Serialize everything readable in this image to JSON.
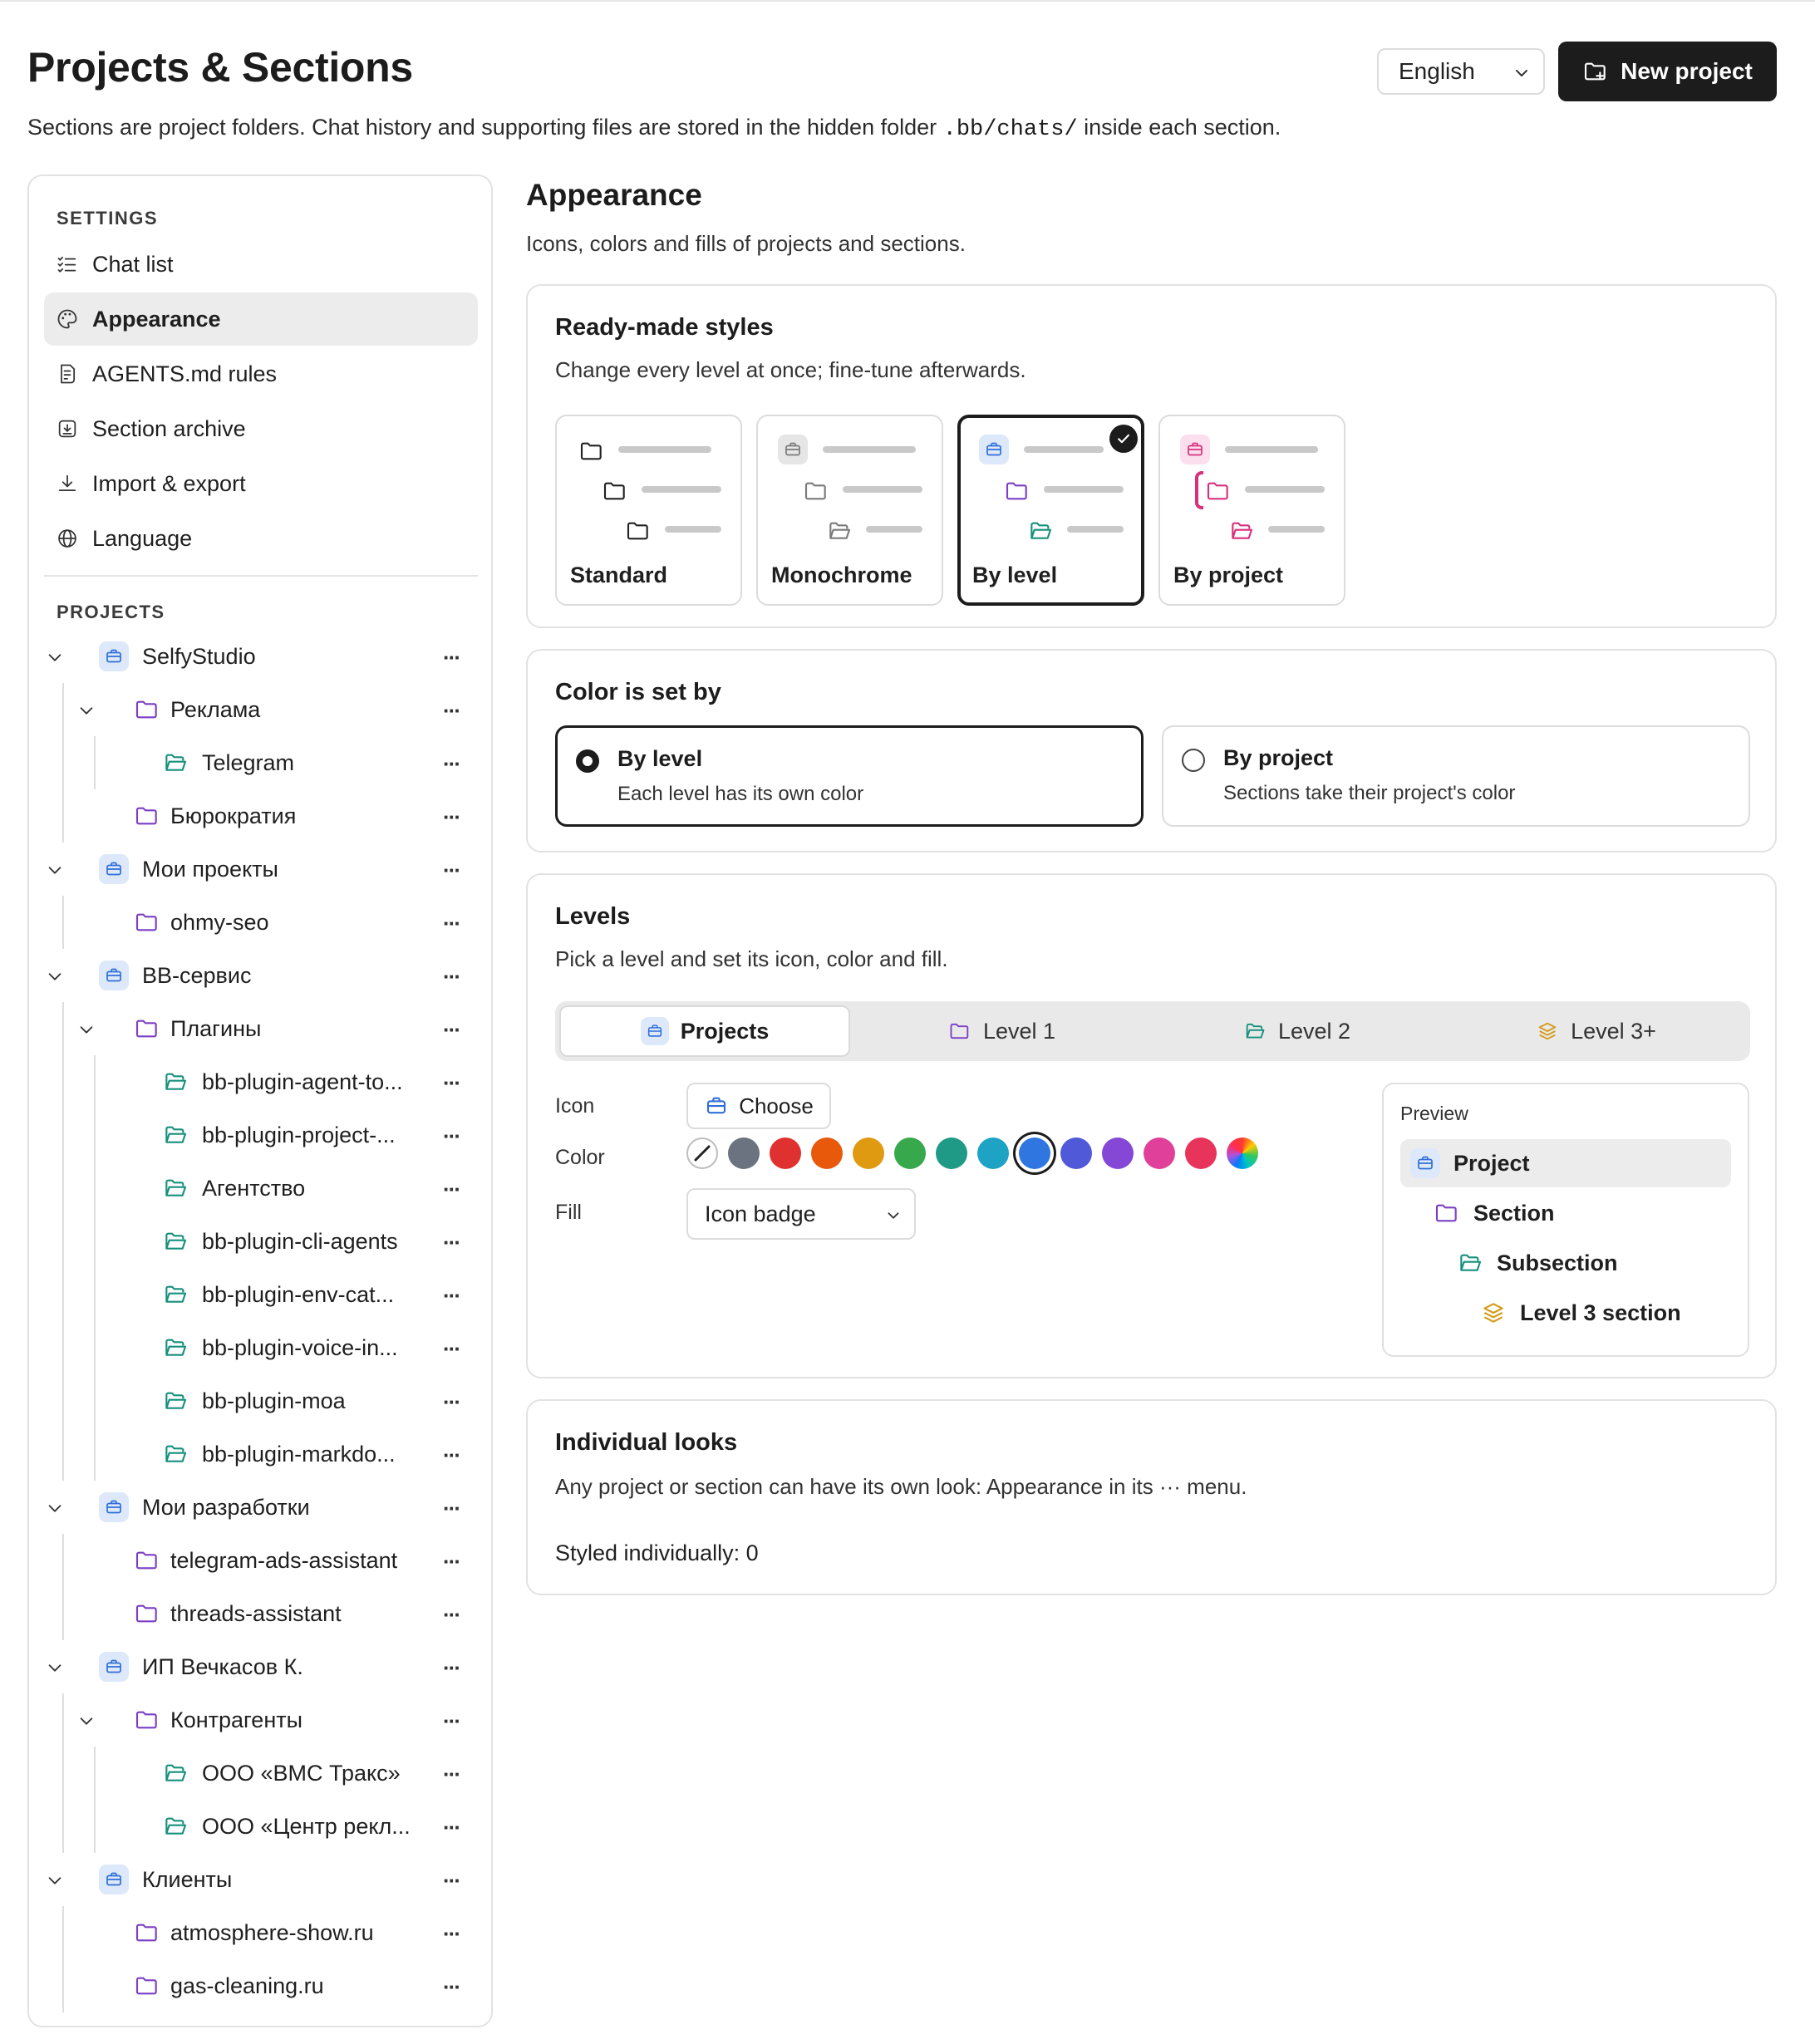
{
  "header": {
    "title": "Projects & Sections",
    "subtitle_before": "Sections are project folders. Chat history and supporting files are stored in the hidden folder ",
    "subtitle_code": ".bb/chats/",
    "subtitle_after": " inside each section.",
    "language": "English",
    "new_project_label": "New project"
  },
  "sidebar": {
    "settings_label": "SETTINGS",
    "settings_items": [
      {
        "label": "Chat list",
        "icon": "list-check-icon"
      },
      {
        "label": "Appearance",
        "icon": "palette-icon",
        "active": true
      },
      {
        "label": "AGENTS.md rules",
        "icon": "document-icon"
      },
      {
        "label": "Section archive",
        "icon": "archive-icon"
      },
      {
        "label": "Import & export",
        "icon": "download-icon"
      },
      {
        "label": "Language",
        "icon": "globe-icon"
      }
    ],
    "projects_label": "PROJECTS",
    "tree": [
      {
        "label": "SelfyStudio",
        "level": 0,
        "expanded": true
      },
      {
        "label": "Реклама",
        "level": 1,
        "expanded": true
      },
      {
        "label": "Telegram",
        "level": 2
      },
      {
        "label": "Бюрократия",
        "level": 1
      },
      {
        "label": "Мои проекты",
        "level": 0,
        "expanded": true
      },
      {
        "label": "ohmy-seo",
        "level": 1
      },
      {
        "label": "BB-сервис",
        "level": 0,
        "expanded": true
      },
      {
        "label": "Плагины",
        "level": 1,
        "expanded": true
      },
      {
        "label": "bb-plugin-agent-to...",
        "level": 2
      },
      {
        "label": "bb-plugin-project-...",
        "level": 2
      },
      {
        "label": "Агентство",
        "level": 2
      },
      {
        "label": "bb-plugin-cli-agents",
        "level": 2
      },
      {
        "label": "bb-plugin-env-cat...",
        "level": 2
      },
      {
        "label": "bb-plugin-voice-in...",
        "level": 2
      },
      {
        "label": "bb-plugin-moa",
        "level": 2
      },
      {
        "label": "bb-plugin-markdo...",
        "level": 2
      },
      {
        "label": "Мои разработки",
        "level": 0,
        "expanded": true
      },
      {
        "label": "telegram-ads-assistant",
        "level": 1
      },
      {
        "label": "threads-assistant",
        "level": 1
      },
      {
        "label": "ИП Вечкасов К.",
        "level": 0,
        "expanded": true
      },
      {
        "label": "Контрагенты",
        "level": 1,
        "expanded": true
      },
      {
        "label": "ООО «ВМС Тракс»",
        "level": 2
      },
      {
        "label": "ООО «Центр рекл...",
        "level": 2
      },
      {
        "label": "Клиенты",
        "level": 0,
        "expanded": true
      },
      {
        "label": "atmosphere-show.ru",
        "level": 1
      },
      {
        "label": "gas-cleaning.ru",
        "level": 1
      }
    ],
    "more_glyph": "···"
  },
  "main": {
    "title": "Appearance",
    "subtitle": "Icons, colors and fills of projects and sections.",
    "ready_made": {
      "title": "Ready-made styles",
      "subtitle": "Change every level at once; fine-tune afterwards.",
      "styles": [
        "Standard",
        "Monochrome",
        "By level",
        "By project"
      ],
      "selected": "By level"
    },
    "color_set_by": {
      "title": "Color is set by",
      "options": [
        {
          "title": "By level",
          "desc": "Each level has its own color",
          "selected": true
        },
        {
          "title": "By project",
          "desc": "Sections take their project's color",
          "selected": false
        }
      ]
    },
    "levels": {
      "title": "Levels",
      "subtitle": "Pick a level and set its icon, color and fill.",
      "tabs": [
        "Projects",
        "Level 1",
        "Level 2",
        "Level 3+"
      ],
      "active_tab": "Projects",
      "icon_label": "Icon",
      "choose_label": "Choose",
      "color_label": "Color",
      "fill_label": "Fill",
      "fill_value": "Icon badge",
      "colors": [
        "none",
        "#6b7280",
        "#e03131",
        "#e8590c",
        "#e09a12",
        "#37a84b",
        "#1f9a86",
        "#1fa3c4",
        "#2f76e0",
        "#5059d8",
        "#8447d6",
        "#e0409a",
        "#e8345a",
        "rainbow"
      ],
      "selected_color": "#2f76e0",
      "preview": {
        "title": "Preview",
        "rows": [
          "Project",
          "Section",
          "Subsection",
          "Level 3 section"
        ]
      }
    },
    "individual": {
      "title": "Individual looks",
      "subtitle": "Any project or section can have its own look: Appearance in its ··· menu.",
      "stat": "Styled individually: 0"
    }
  },
  "colors": {
    "project_blue": "#2f6fd6",
    "section_purple": "#7b3fc4",
    "subsection_teal": "#16907c",
    "level3_amber": "#d49a16",
    "monochrome_gray": "#7a7a7a",
    "byproject_pink": "#d8307c"
  }
}
